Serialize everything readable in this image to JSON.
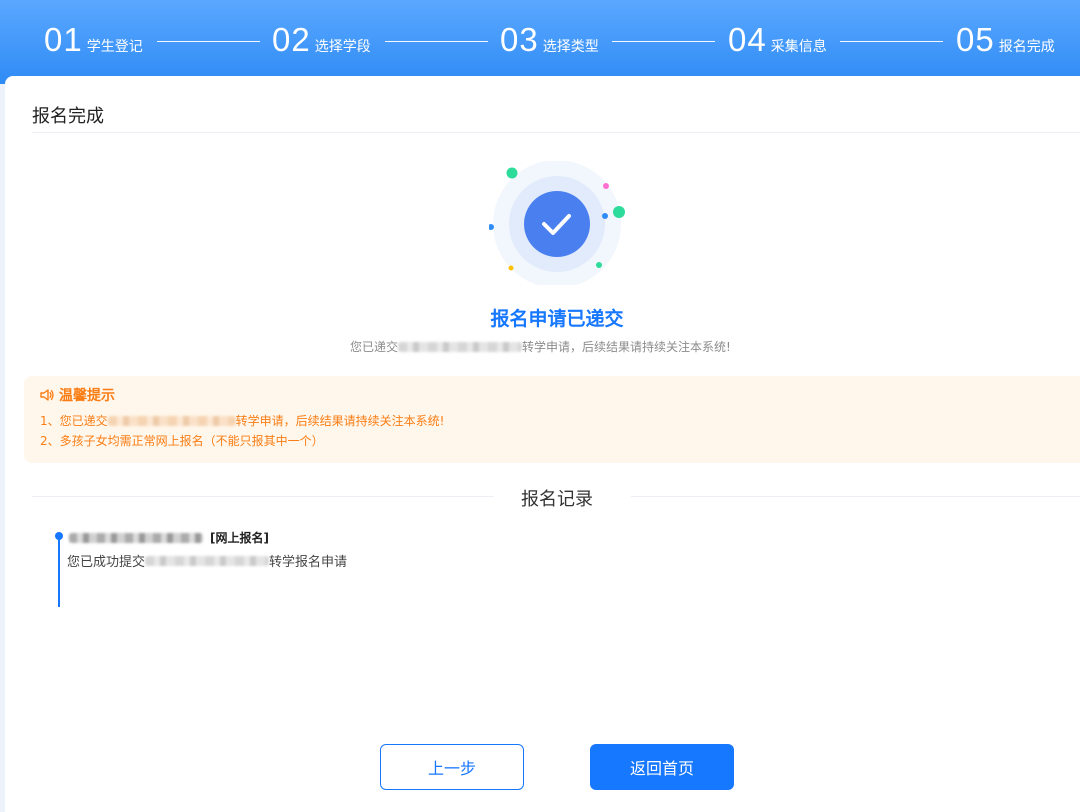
{
  "steps": [
    {
      "num": "01",
      "label": "学生登记"
    },
    {
      "num": "02",
      "label": "选择学段"
    },
    {
      "num": "03",
      "label": "选择类型"
    },
    {
      "num": "04",
      "label": "采集信息"
    },
    {
      "num": "05",
      "label": "报名完成"
    }
  ],
  "page": {
    "section_title": "报名完成"
  },
  "success": {
    "title": "报名申请已递交",
    "desc_prefix": "您已递交",
    "desc_suffix": "转学申请，后续结果请持续关注本系统!"
  },
  "tips": {
    "title": "温馨提示",
    "line1_prefix": "1、您已递交",
    "line1_suffix": "转学申请，后续结果请持续关注本系统!",
    "line2": "2、多孩子女均需正常网上报名（不能只报其中一个）"
  },
  "records": {
    "title": "报名记录",
    "items": [
      {
        "tag": "[网上报名]",
        "body_prefix": "您已成功提交",
        "body_suffix": "转学报名申请"
      }
    ]
  },
  "buttons": {
    "prev": "上一步",
    "home": "返回首页"
  },
  "colors": {
    "primary": "#1677ff",
    "tip": "#fa7d14",
    "tip_bg": "#fff7ec"
  }
}
